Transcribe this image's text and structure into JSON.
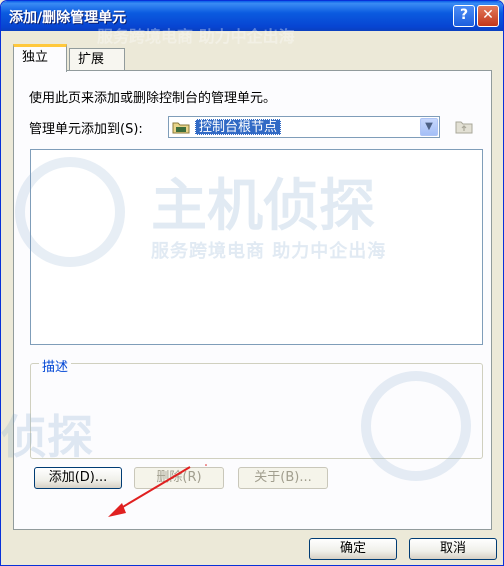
{
  "window": {
    "title": "添加/删除管理单元"
  },
  "titlebar": {
    "help_label": "?",
    "close_label": "✕"
  },
  "tabs": [
    {
      "label": "独立",
      "active": true
    },
    {
      "label": "扩展",
      "active": false
    }
  ],
  "standalone": {
    "description": "使用此页来添加或删除控制台的管理单元。",
    "add_to_label": "管理单元添加到(S):",
    "add_to_value": "控制台根节点",
    "snapins": [],
    "group_label": "描述"
  },
  "buttons": {
    "add": "添加(D)...",
    "remove": "删除(R)",
    "about": "关于(B)...",
    "ok": "确定",
    "cancel": "取消"
  },
  "watermark": {
    "brand": "主机侦探",
    "slogan": "服务跨境电商 助力中企出海",
    "top_text": "服务跨境电商 助力中企出海",
    "left_text": "侦探"
  },
  "colors": {
    "titlebar": "#0B5BE0",
    "selection": "#316AC5",
    "group_label": "#0046D5",
    "arrow": "#E02020"
  }
}
